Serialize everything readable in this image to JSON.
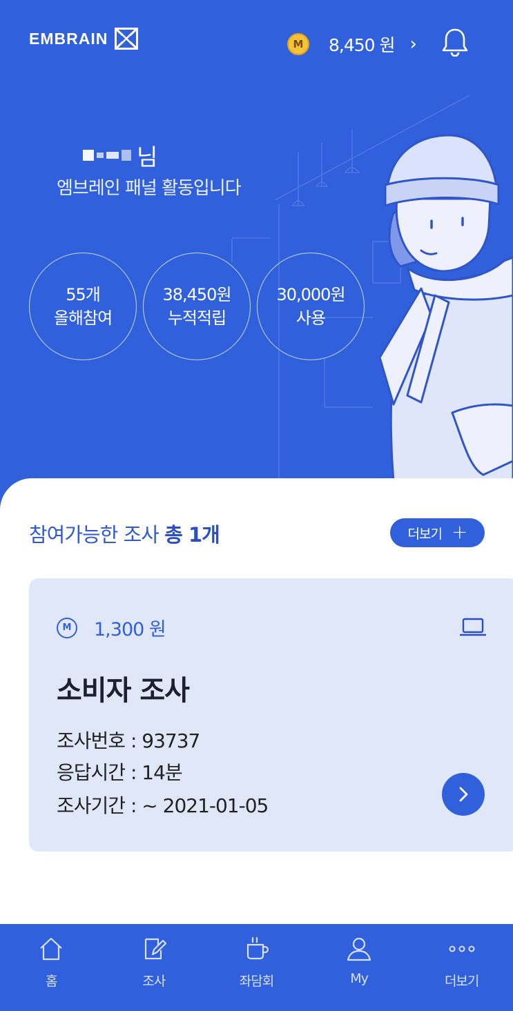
{
  "app": {
    "logo_text": "EMBRAIN",
    "points_badge": "M",
    "points_value": "8,450 원",
    "points_chevron": "›"
  },
  "user": {
    "name_suffix": "님",
    "greeting": "엠브레인 패널 활동입니다"
  },
  "stats": [
    {
      "value": "55개",
      "label": "올해참여"
    },
    {
      "value": "38,450원",
      "label": "누적적립"
    },
    {
      "value": "30,000원",
      "label": "사용"
    }
  ],
  "surveys": {
    "title_prefix": "참여가능한 조사",
    "title_count": "총 1개",
    "more_label": "더보기",
    "more_plus": "+",
    "card": {
      "reward_badge": "M",
      "reward_value": "1,300 원",
      "title": "소비자 조사",
      "meta": [
        "조사번호 : 93737",
        "응답시간 : 14분",
        "조사기간 : ~ 2021-01-05"
      ]
    }
  },
  "tabs": [
    {
      "label": "홈",
      "icon": "home-icon"
    },
    {
      "label": "조사",
      "icon": "survey-edit-icon"
    },
    {
      "label": "좌담회",
      "icon": "coffee-cup-icon"
    },
    {
      "label": "My",
      "icon": "user-icon"
    },
    {
      "label": "더보기",
      "icon": "more-dots-icon"
    }
  ],
  "colors": {
    "primary": "#3160dc",
    "card_bg": "#dfe7f9",
    "coin": "#f5c23a"
  }
}
